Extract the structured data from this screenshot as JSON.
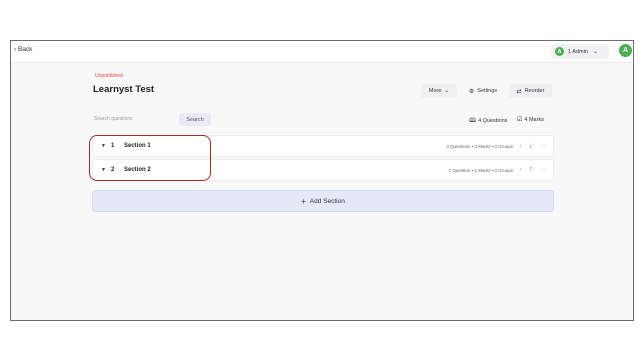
{
  "topbar": {
    "back_label": "Back",
    "admin_initial": "A",
    "admin_label": "1 Admin",
    "avatar_initial": "A"
  },
  "test": {
    "status": "Unpublished",
    "title": "Learnyst Test"
  },
  "toolbar": {
    "more_label": "More",
    "settings_label": "Settings",
    "reorder_label": "Reorder"
  },
  "search": {
    "placeholder": "Search questions",
    "button_label": "Search"
  },
  "summary": {
    "questions": "4 Questions",
    "marks": "4 Marks"
  },
  "sections": [
    {
      "number": "1",
      "name": "Section 1",
      "meta": "3 Questions  •  3 Marks  •  0 Groups"
    },
    {
      "number": "2",
      "name": "Section 2",
      "meta": "1 Question  •  1 Marks  •  0 Groups"
    }
  ],
  "add_section_label": "Add Section",
  "colors": {
    "status": "#e54848",
    "avatar": "#4caf50",
    "add_section_bg": "#e5e9f7",
    "highlight": "#a32c2c"
  },
  "icons": {
    "back": "chevron-left-icon",
    "settings": "gear-icon",
    "reorder": "swap-icon",
    "questions": "book-icon",
    "marks": "checkbox-icon",
    "expand": "chevron-down-icon",
    "move_up": "arrow-up-icon",
    "move_down": "arrow-down-icon",
    "more": "ellipsis-icon",
    "add": "plus-icon"
  }
}
